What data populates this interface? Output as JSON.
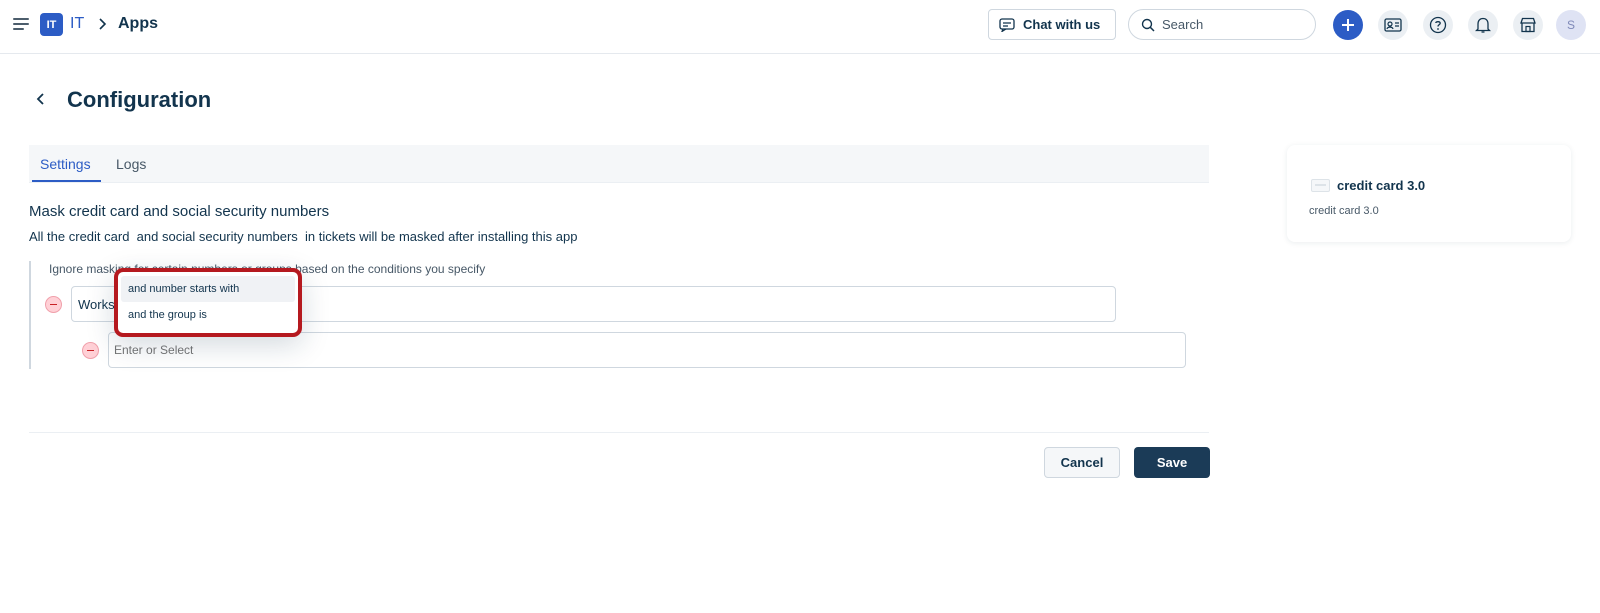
{
  "header": {
    "workspace_badge": "IT",
    "workspace_name": "IT",
    "breadcrumb_current": "Apps",
    "chat_label": "Chat with us",
    "search_placeholder": "Search",
    "avatar_initial": "S",
    "accent_color": "#2c5cc5"
  },
  "page": {
    "title": "Configuration"
  },
  "tabs": [
    {
      "label": "Settings",
      "active": true
    },
    {
      "label": "Logs",
      "active": false
    }
  ],
  "section": {
    "title": "Mask credit card and social security numbers",
    "desc_prefix": "All the ",
    "desc_term1": "credit card",
    "desc_mid": "  and ",
    "desc_term2": "social security numbers",
    "desc_suffix": "  in tickets will be masked after installing this app",
    "conditions_note": "Ignore masking for certain numbers or groups based on the conditions you specify"
  },
  "conditions": {
    "field1_value": "Works",
    "field2_placeholder": "Enter or Select"
  },
  "dropdown": {
    "options": [
      "and number starts with",
      "and the group is"
    ],
    "highlight_color": "#b5191f"
  },
  "footer": {
    "cancel_label": "Cancel",
    "save_label": "Save"
  },
  "app_card": {
    "name": "credit card 3.0",
    "subtitle": "credit card 3.0"
  }
}
